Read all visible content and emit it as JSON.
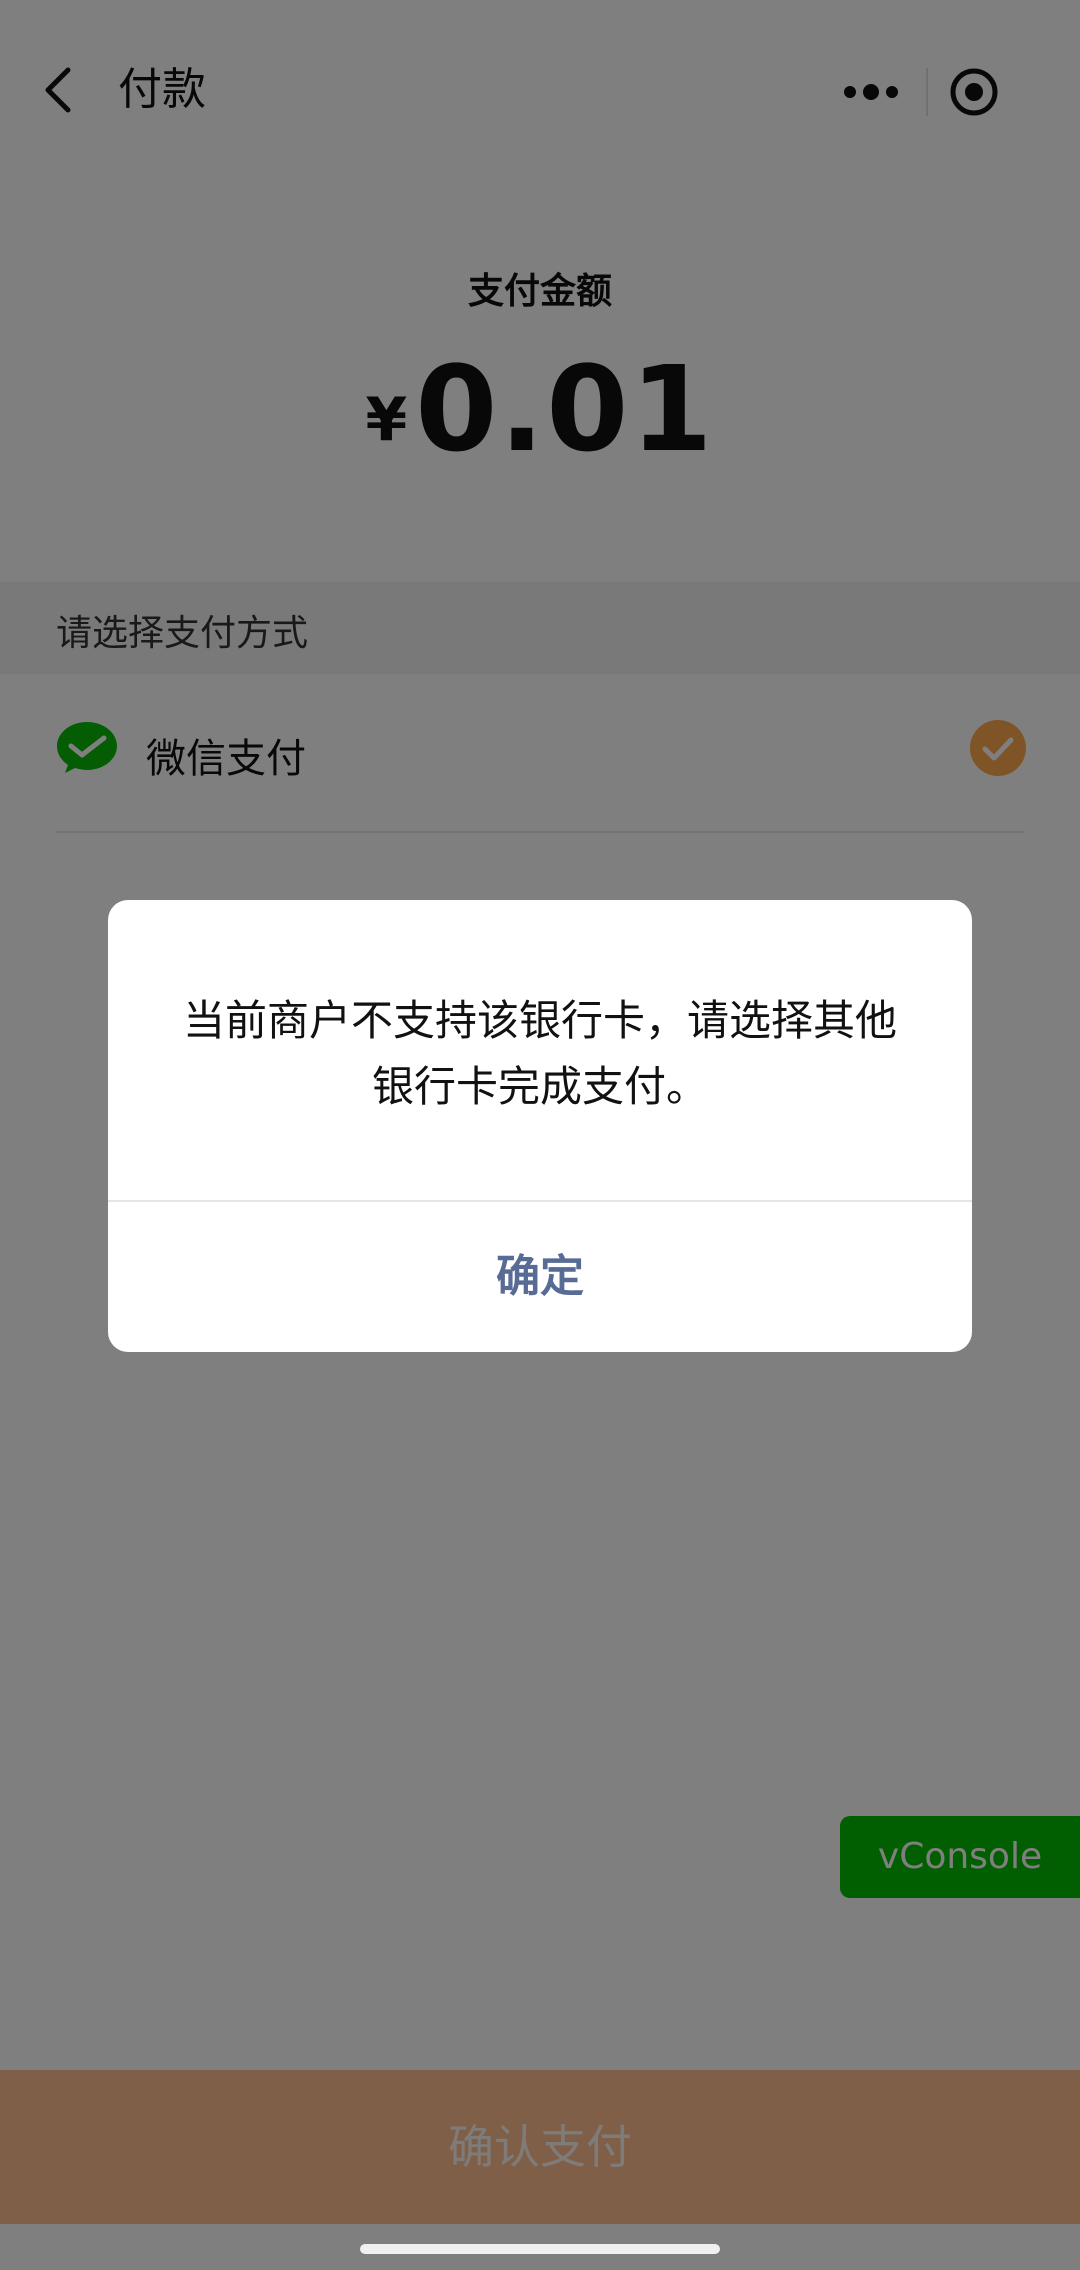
{
  "header": {
    "title": "付款",
    "back_icon": "chevron-left-icon",
    "more_icon": "more-dots-icon",
    "close_icon": "target-close-icon"
  },
  "amount": {
    "label": "支付金额",
    "currency": "¥",
    "value": "0.01"
  },
  "payment": {
    "section_title": "请选择支付方式",
    "methods": [
      {
        "label": "微信支付",
        "icon": "wechat-pay-icon",
        "selected": true
      }
    ]
  },
  "dialog": {
    "message": "当前商户不支持该银行卡，请选择其他银行卡完成支付。",
    "confirm_label": "确定"
  },
  "vconsole": {
    "label": "vConsole"
  },
  "footer": {
    "confirm_label": "确认支付"
  },
  "colors": {
    "wechat_green": "#09bb07",
    "check_orange": "#ffa94d",
    "dialog_link": "#576b95",
    "vconsole_green": "#04be02",
    "confirm_button": "#ffbf8f"
  }
}
